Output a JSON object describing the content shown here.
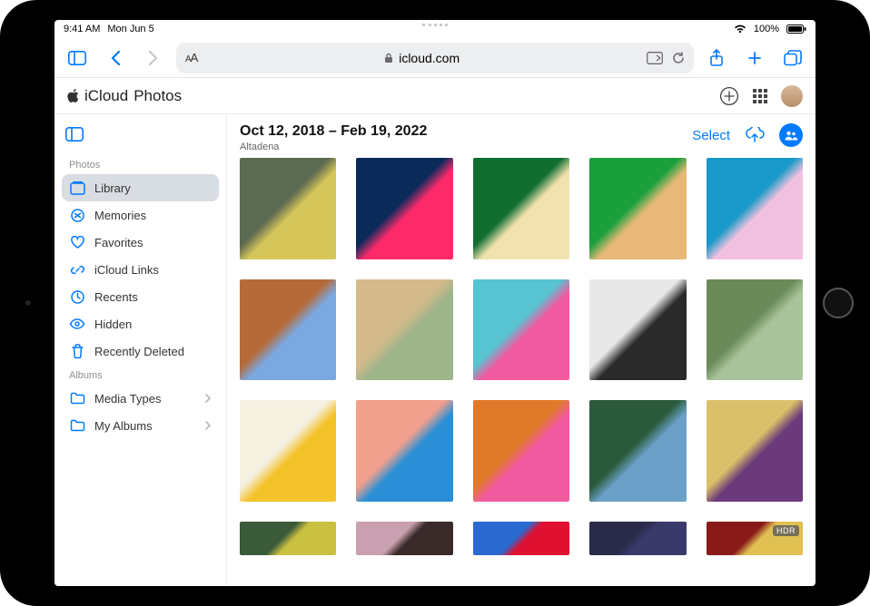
{
  "status": {
    "time": "9:41 AM",
    "date": "Mon Jun 5",
    "battery": "100%"
  },
  "safari": {
    "url_display": "icloud.com"
  },
  "app": {
    "brand": "iCloud",
    "product": "Photos"
  },
  "header_actions": {
    "select": "Select"
  },
  "grid_header": {
    "date_range": "Oct 12, 2018 – Feb 19, 2022",
    "location": "Altadena"
  },
  "sidebar": {
    "sections": [
      {
        "title": "Photos",
        "items": [
          {
            "label": "Library",
            "icon": "library-icon",
            "active": true,
            "chevron": false
          },
          {
            "label": "Memories",
            "icon": "memories-icon",
            "active": false,
            "chevron": false
          },
          {
            "label": "Favorites",
            "icon": "heart-icon",
            "active": false,
            "chevron": false
          },
          {
            "label": "iCloud Links",
            "icon": "link-icon",
            "active": false,
            "chevron": false
          },
          {
            "label": "Recents",
            "icon": "clock-icon",
            "active": false,
            "chevron": false
          },
          {
            "label": "Hidden",
            "icon": "eye-slash-icon",
            "active": false,
            "chevron": false
          },
          {
            "label": "Recently Deleted",
            "icon": "trash-icon",
            "active": false,
            "chevron": false
          }
        ]
      },
      {
        "title": "Albums",
        "items": [
          {
            "label": "Media Types",
            "icon": "folder-icon",
            "active": false,
            "chevron": true
          },
          {
            "label": "My Albums",
            "icon": "folder-icon",
            "active": false,
            "chevron": true
          }
        ]
      }
    ]
  },
  "thumbs": {
    "row4_badge": "HDR",
    "colors": [
      [
        "#5b6a50,#d6c65a",
        "#0a2a5a,#ff2a6a",
        "#0f6e2f,#f2e2b0",
        "#1aa03a,#e7b878",
        "#1a99c8,#f3c1e0"
      ],
      [
        "#b56a3a,#7aa8e0",
        "#d4b98a,#9fb58a",
        "#58c3d1,#f25aa0",
        "#e8e8e8,#2a2a2a",
        "#6a8a5a,#a9c49a"
      ],
      [
        "#f5f0e0,#f4c22a",
        "#f0a08c,#2a8fd6",
        "#e07a2a,#f25aa0",
        "#2a5a3a,#6aa0c8",
        "#dac06a,#6a3a7a"
      ],
      [
        "#3a5a3a,#c9c040",
        "#caa0b0,#3a2a2a",
        "#2a6ad0,#e01030",
        "#2a2a4a,#3a3a6a",
        "#8a1a1a,#e0c050"
      ]
    ]
  }
}
